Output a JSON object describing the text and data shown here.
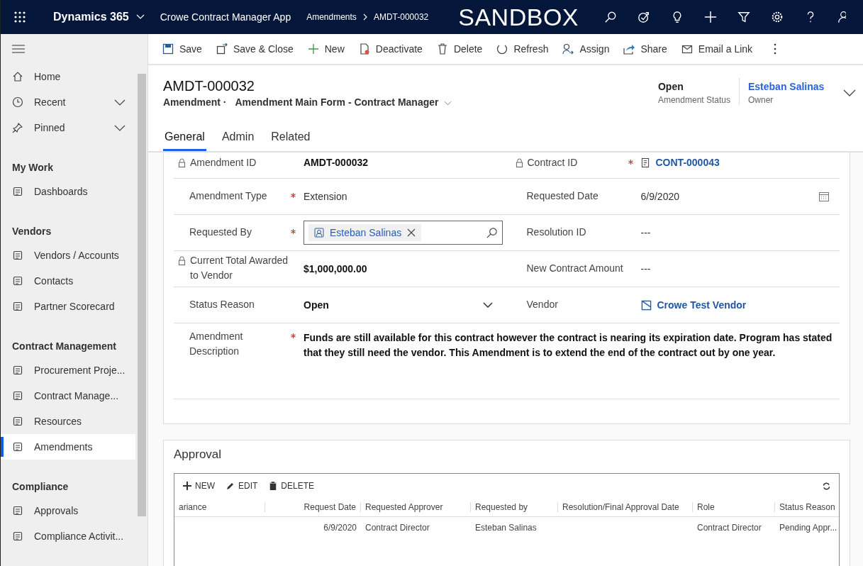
{
  "topbar": {
    "app_name": "Dynamics 365",
    "app_title": "Crowe Contract Manager App",
    "breadcrumb": [
      "Amendments",
      "AMDT-000032"
    ],
    "environment": "SANDBOX"
  },
  "commands": [
    {
      "label": "Save"
    },
    {
      "label": "Save & Close"
    },
    {
      "label": "New"
    },
    {
      "label": "Deactivate"
    },
    {
      "label": "Delete"
    },
    {
      "label": "Refresh"
    },
    {
      "label": "Assign"
    },
    {
      "label": "Share"
    },
    {
      "label": "Email a Link"
    }
  ],
  "sidebar": {
    "sections": [
      {
        "items": [
          {
            "label": "Home",
            "kind": "link",
            "selected": false
          },
          {
            "label": "Recent",
            "kind": "group",
            "selected": false
          },
          {
            "label": "Pinned",
            "kind": "group",
            "selected": false
          }
        ]
      },
      {
        "title": "My Work",
        "items": [
          {
            "label": "Dashboards",
            "kind": "link",
            "selected": false
          }
        ]
      },
      {
        "title": "Vendors",
        "items": [
          {
            "label": "Vendors / Accounts",
            "kind": "link",
            "selected": false
          },
          {
            "label": "Contacts",
            "kind": "link",
            "selected": false
          },
          {
            "label": "Partner Scorecard",
            "kind": "link",
            "selected": false
          }
        ]
      },
      {
        "title": "Contract Management",
        "items": [
          {
            "label": "Procurement Proje...",
            "kind": "link",
            "selected": false
          },
          {
            "label": "Contract Manage...",
            "kind": "link",
            "selected": false
          },
          {
            "label": "Resources",
            "kind": "link",
            "selected": false
          },
          {
            "label": "Amendments",
            "kind": "link",
            "selected": true
          }
        ]
      },
      {
        "title": "Compliance",
        "items": [
          {
            "label": "Approvals",
            "kind": "link",
            "selected": false
          },
          {
            "label": "Compliance Activit...",
            "kind": "link",
            "selected": false
          }
        ]
      }
    ]
  },
  "record": {
    "title": "AMDT-000032",
    "entity": "Amendment ·",
    "form": "Amendment Main Form - Contract Manager",
    "status": {
      "value": "Open",
      "label": "Amendment Status"
    },
    "owner": {
      "value": "Esteban Salinas",
      "label": "Owner"
    }
  },
  "tabs": [
    {
      "label": "General",
      "selected": true
    },
    {
      "label": "Admin",
      "selected": false
    },
    {
      "label": "Related",
      "selected": false
    }
  ],
  "fields": [
    [
      {
        "label": "Amendment ID",
        "value": "AMDT-000032",
        "kind": "readonly",
        "required": false,
        "locked": true
      },
      {
        "label": "Contract ID",
        "value": "CONT-000043",
        "kind": "link",
        "required": true,
        "locked": true
      }
    ],
    [
      {
        "label": "Amendment Type",
        "value": "Extension",
        "kind": "text",
        "required": true,
        "locked": false
      },
      {
        "label": "Requested Date",
        "value": "6/9/2020",
        "kind": "date",
        "required": false,
        "locked": false
      }
    ],
    [
      {
        "label": "Requested By",
        "value": "Esteban Salinas",
        "kind": "lookup",
        "required": true,
        "locked": false
      },
      {
        "label": "Resolution ID",
        "value": "---",
        "kind": "text",
        "required": false,
        "locked": false
      }
    ],
    [
      {
        "label": "Current Total Awarded to Vendor",
        "value": "$1,000,000.00",
        "kind": "readonly",
        "required": false,
        "locked": true
      },
      {
        "label": "New Contract Amount",
        "value": "---",
        "kind": "text",
        "required": false,
        "locked": false
      }
    ],
    [
      {
        "label": "Status Reason",
        "value": "Open",
        "kind": "dropdown",
        "required": false,
        "locked": false
      },
      {
        "label": "Vendor",
        "value": "Crowe Test Vendor",
        "kind": "account",
        "required": false,
        "locked": false
      }
    ],
    [
      {
        "label": "Amendment Description",
        "value": "Funds are still available for this contract however the contract is nearing its expiration date.  Program has stated that they still need the vendor. This Amendment is to extend the end of the contract out by one year.",
        "kind": "description",
        "required": true,
        "locked": false
      }
    ]
  ],
  "approval": {
    "title": "Approval",
    "commands": [
      "NEW",
      "EDIT",
      "DELETE"
    ],
    "columns": [
      "ariance",
      "Request Date",
      "Requested Approver",
      "Requested by",
      "Resolution/Final Approval Date",
      "Role",
      "Status Reason"
    ],
    "rows": [
      [
        "",
        "6/9/2020",
        "Contract Director",
        "Esteban Salinas",
        "",
        "Contract Director",
        "Pending Appr..."
      ]
    ]
  }
}
